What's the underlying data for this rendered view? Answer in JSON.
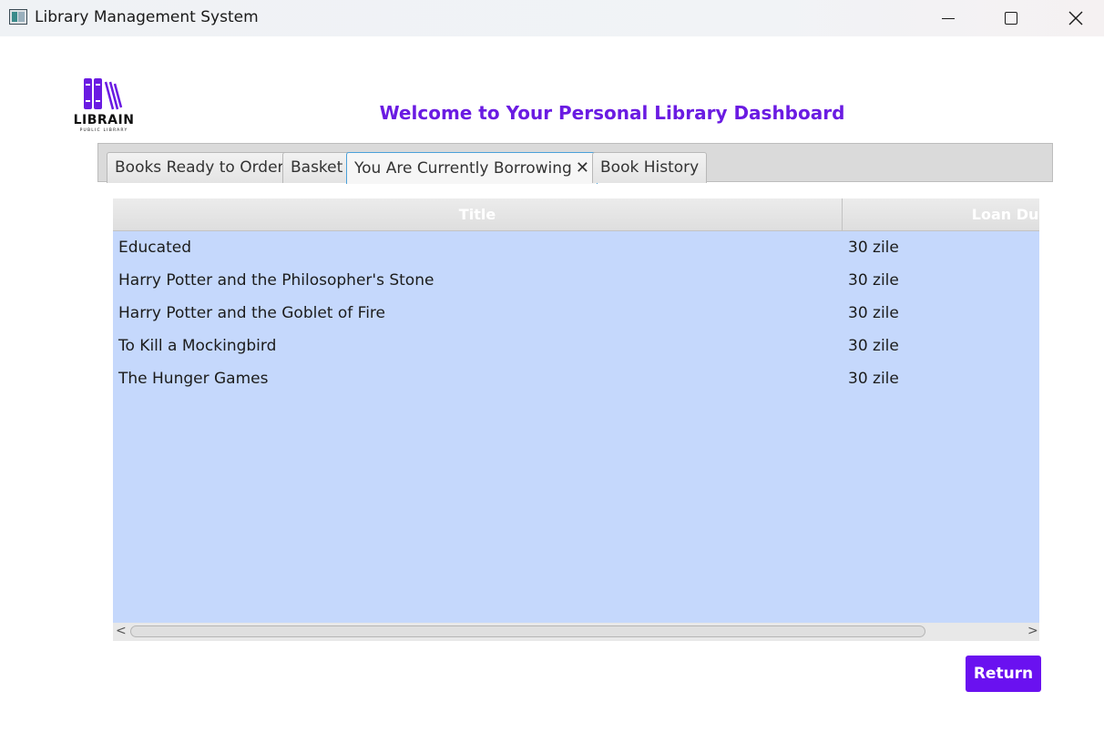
{
  "window": {
    "title": "Library Management System"
  },
  "logo": {
    "name": "LIBRAIN",
    "subtitle": "PUBLIC LIBRARY",
    "color": "#6a1be2"
  },
  "header": {
    "title": "Welcome to Your Personal Library Dashboard",
    "color": "#6a1be2"
  },
  "tabs": [
    {
      "label": "Books Ready to Order",
      "active": false
    },
    {
      "label": "Basket",
      "active": false
    },
    {
      "label": "You Are Currently Borrowing",
      "active": true,
      "closable": true
    },
    {
      "label": "Book History",
      "active": false
    }
  ],
  "table": {
    "columns": [
      "Title",
      "Loan Duratio"
    ],
    "rows": [
      {
        "title": "Educated",
        "loan": "30 zile"
      },
      {
        "title": "Harry Potter and the Philosopher's Stone",
        "loan": "30 zile"
      },
      {
        "title": "Harry Potter and the Goblet of Fire",
        "loan": "30 zile"
      },
      {
        "title": "To Kill a Mockingbird",
        "loan": "30 zile"
      },
      {
        "title": "The Hunger Games",
        "loan": "30 zile"
      }
    ],
    "row_color": "#c5d8fc"
  },
  "actions": {
    "return_label": "Return",
    "accent": "#6a11f0"
  },
  "icons": {
    "minimize": "minimize-icon",
    "maximize": "maximize-icon",
    "close": "close-icon",
    "tab_close": "close-icon",
    "scroll_left": "chevron-left-icon",
    "scroll_right": "chevron-right-icon"
  }
}
